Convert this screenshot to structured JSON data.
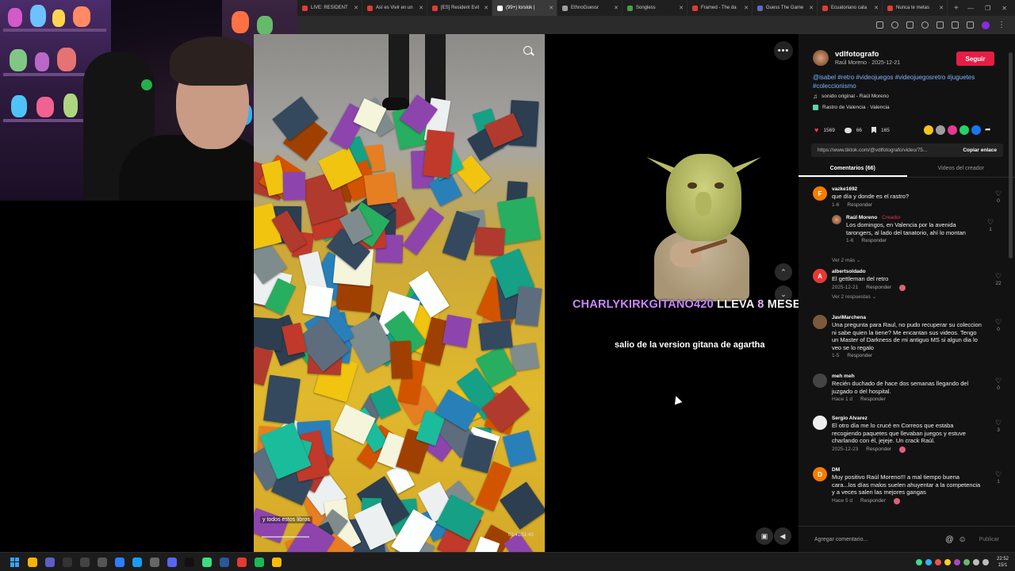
{
  "browser": {
    "tabs": [
      {
        "label": "LIVE: RESIDENT",
        "color": "#e53935"
      },
      {
        "label": "Así es Vivir en un",
        "color": "#e53935"
      },
      {
        "label": "[ES] Resident Evil",
        "color": "#e53935"
      },
      {
        "label": "(99+) lorslok |",
        "color": "#ffffff",
        "active": true
      },
      {
        "label": "EthnoGuessr",
        "color": "#9e9e9e"
      },
      {
        "label": "Songless",
        "color": "#43a047"
      },
      {
        "label": "Framed - The da",
        "color": "#e53935"
      },
      {
        "label": "Guess The Game",
        "color": "#5c6bc0"
      },
      {
        "label": "Ecuatoriano cata",
        "color": "#e53935"
      },
      {
        "label": "Nunca te metas",
        "color": "#e53935"
      }
    ],
    "new_tab": "+",
    "window_controls": [
      "—",
      "❐",
      "✕"
    ]
  },
  "video": {
    "caption": "y todos estos libros",
    "time": "01:41/01:43",
    "more": "•••",
    "up": "⌃",
    "down": "⌄"
  },
  "alert": {
    "user": "CHARLYKIRKGITANO420",
    "mid": " LLEVA ",
    "num": "8",
    "end": " MESES",
    "message": "salio de la version gitana de agartha"
  },
  "post": {
    "username": "vdlfotografo",
    "subline": "Raúl Moreno · 2025-12-21",
    "follow": "Seguir",
    "hashtags": "@isabel #retro #videojuegos #videojuegosretro #juguetes #coleccionismo",
    "sound": "sonido original - Raúl Moreno",
    "location": "Rastro de Valencia · Valencia",
    "likes": "1569",
    "comments": "66",
    "saves": "165",
    "link": "https://www.tiktok.com/@vdlfotografo/video/75...",
    "copy": "Copiar enlace",
    "tab_comments": "Comentarios (66)",
    "tab_videos": "Videos del creador",
    "composer_placeholder": "Agregar comentario...",
    "publish": "Publicar"
  },
  "comments": [
    {
      "initial": "F",
      "color": "#f57c00",
      "user": "vazke1692",
      "text": "que día y donde es el rastro?",
      "date": "1-6",
      "reply": "Responder",
      "likes": "0"
    },
    {
      "initial": "A",
      "color": "#e53935",
      "user": "albertsoldado",
      "text": "El gettleman del retro",
      "date": "2025-12-21",
      "reply": "Responder",
      "likes": "22",
      "more": "Ver 2 respuestas ⌄"
    },
    {
      "initial": "",
      "color": "#7a5a3a",
      "user": "JaviMarchena",
      "text": "Una pregunta para Raul, no pudo recuperar su coleccion ni sabe quien la tiene? Me encantan sus videos. Tengo un Master of Darkness de mi antiguo MS si algun dia lo veo se lo regalo",
      "date": "1-5",
      "reply": "Responder",
      "likes": "0"
    },
    {
      "initial": "",
      "color": "#444444",
      "user": "meh meh",
      "text": "Recién duchado de hace dos semanas llegando del juzgado o del hospital.",
      "date": "Hace 1 d",
      "reply": "Responder",
      "likes": "0"
    },
    {
      "initial": "",
      "color": "#eeeeee",
      "user": "Sergio Alvarez",
      "text": "El otro día me lo crucé en Correos que estaba recogiendo paquetes que llevaban juegos y estuve charlando con él, jejeje. Un crack Raúl.",
      "date": "2025-12-23",
      "reply": "Responder",
      "likes": "3"
    },
    {
      "initial": "D",
      "color": "#f57c00",
      "user": "DM",
      "text": "Muy positivo Raúl Moreno!!! a mal tiempo buena cara...los días malos suelen ahuyentar a la competencia y a veces salen las mejores gangas",
      "date": "Hace 5 d",
      "reply": "Responder",
      "likes": "1"
    }
  ],
  "reply": {
    "user": "Raúl Moreno",
    "tag": " · Creador",
    "text": "Los domingos, en Valencia por la avenida tarongers, al lado del tanatorio, ahí lo montan",
    "date": "1-6",
    "reply": "Responder",
    "likes": "1",
    "more": "Ver 2 más ⌄"
  },
  "taskbar": {
    "time": "22:52",
    "date": "15/1"
  }
}
